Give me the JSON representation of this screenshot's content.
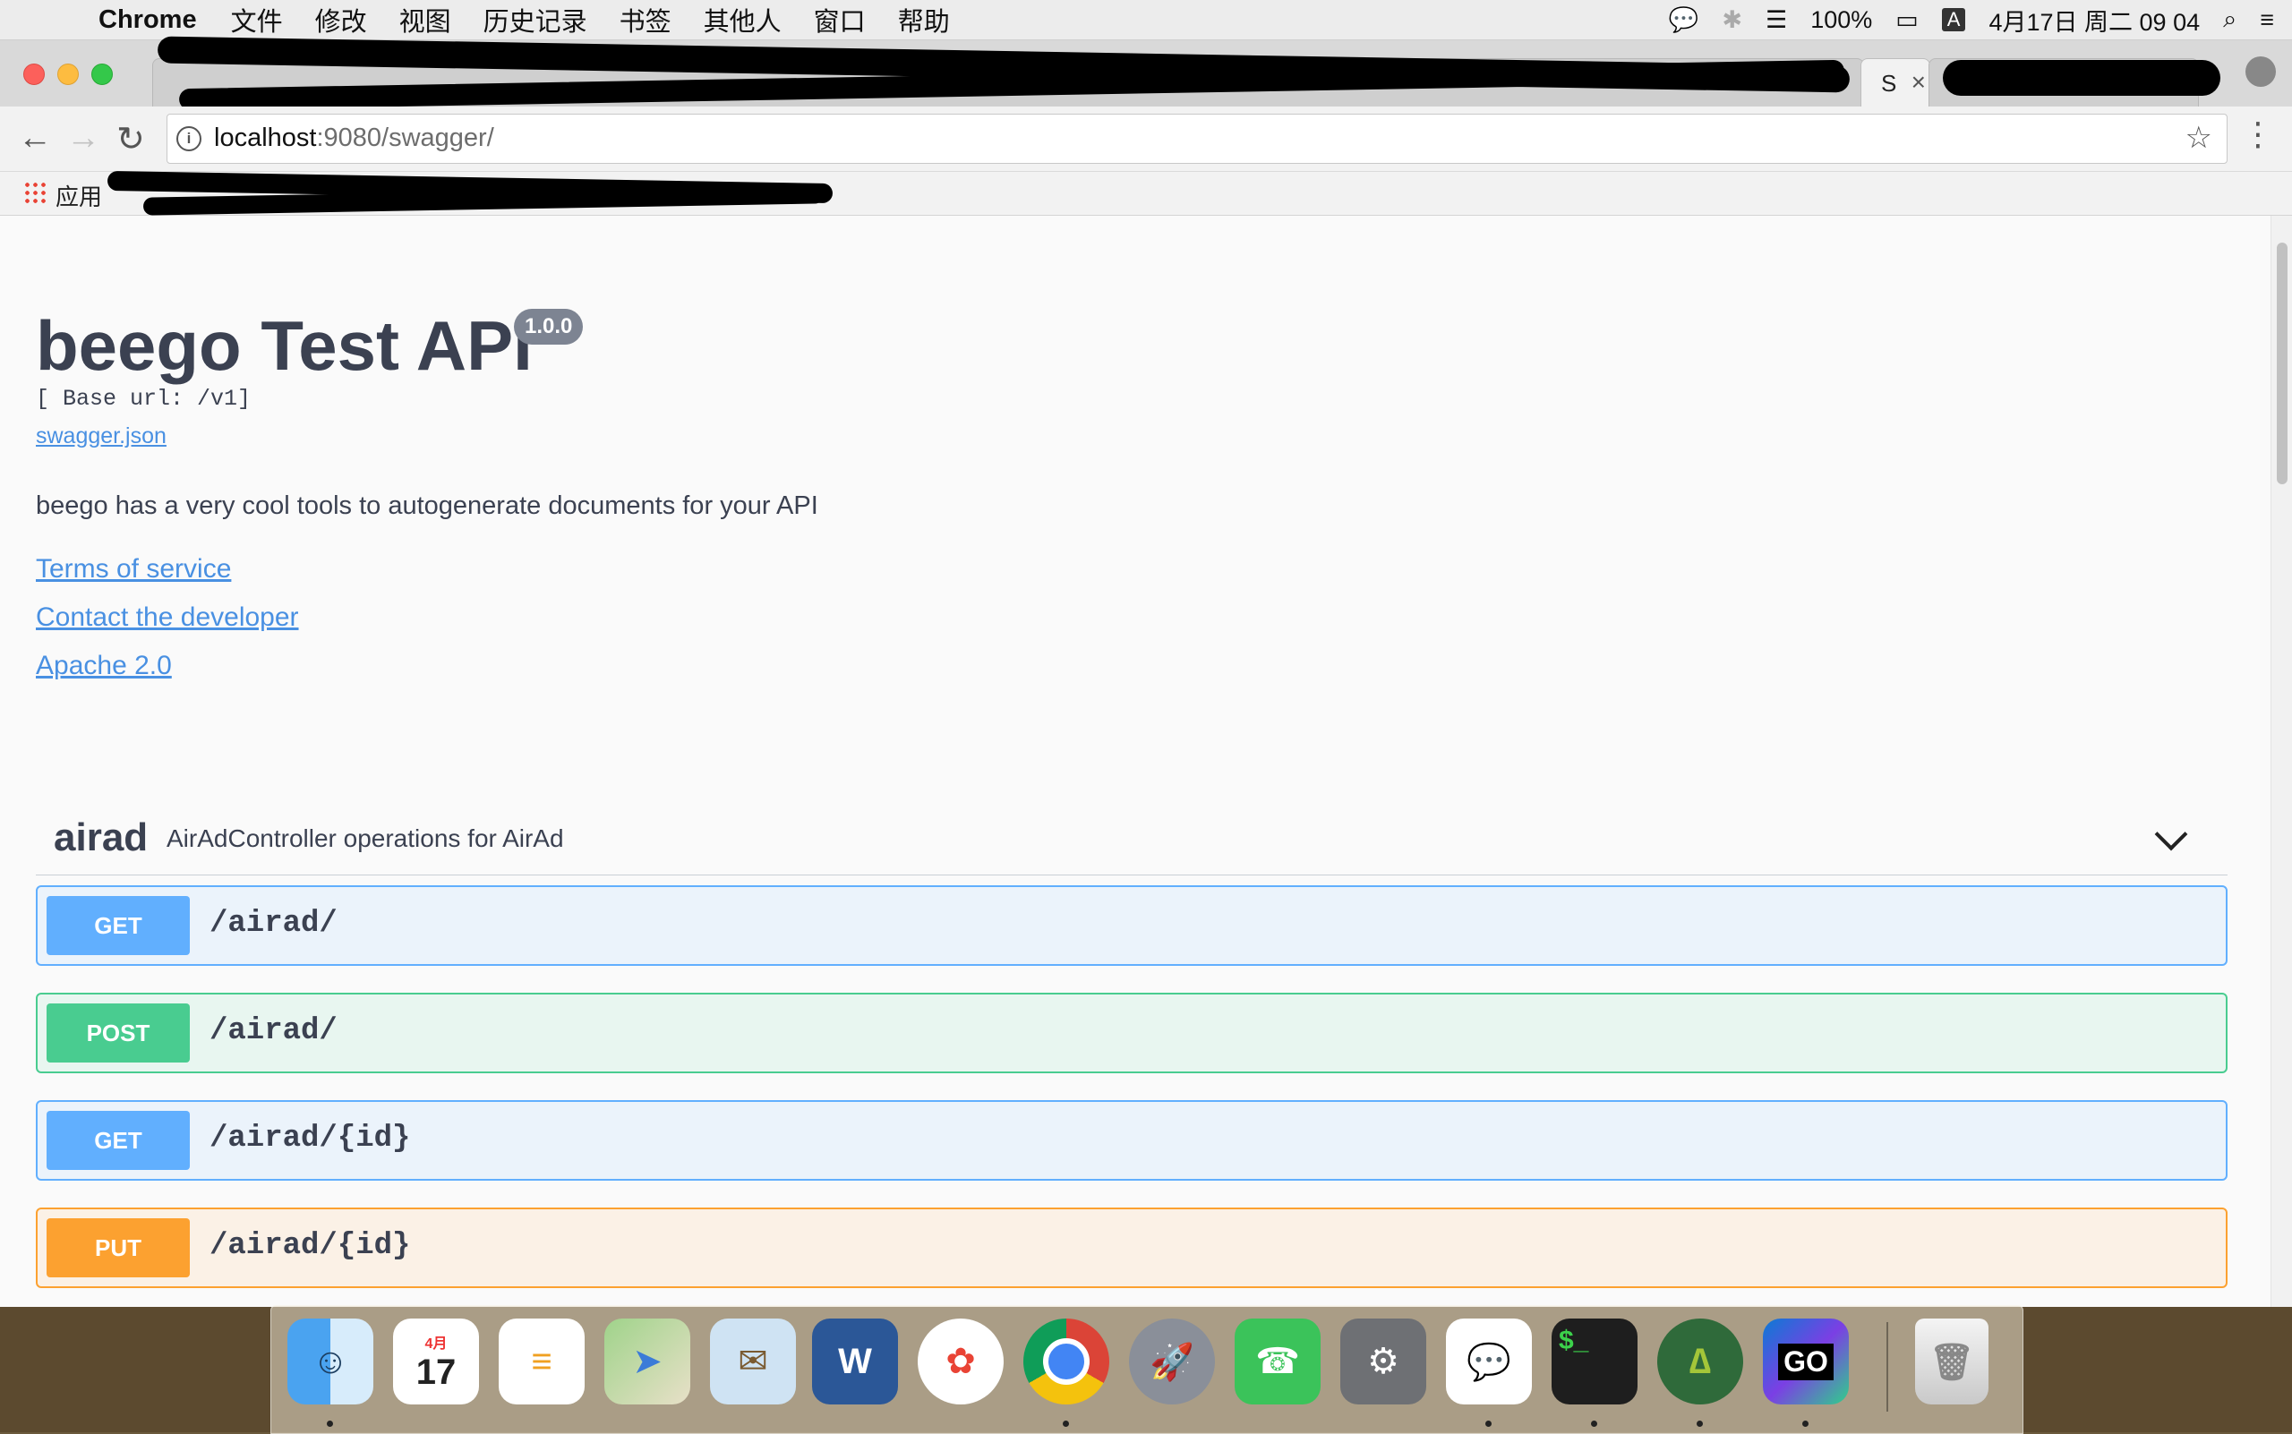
{
  "menubar": {
    "app_name": "Chrome",
    "items": [
      "文件",
      "修改",
      "视图",
      "历史记录",
      "书签",
      "其他人",
      "窗口",
      "帮助"
    ],
    "battery": "100%",
    "ime": "A",
    "datetime": "4月17日 周二  09 04"
  },
  "tabs": {
    "active_title": "S",
    "close_glyph": "×"
  },
  "omnibox": {
    "url_host": "localhost",
    "url_rest": ":9080/swagger/"
  },
  "bookmarks": {
    "apps_label": "应用"
  },
  "api": {
    "title": "beego Test API",
    "version": "1.0.0",
    "base_url": "[ Base url: /v1]",
    "spec_link": "swagger.json",
    "description": "beego has a very cool tools to autogenerate documents for your API",
    "terms_link": "Terms of service",
    "contact_link": "Contact the developer",
    "license_link": "Apache 2.0"
  },
  "tag": {
    "name": "airad",
    "description": "AirAdController operations for AirAd"
  },
  "operations": [
    {
      "method": "GET",
      "path": "/airad/"
    },
    {
      "method": "POST",
      "path": "/airad/"
    },
    {
      "method": "GET",
      "path": "/airad/{id}"
    },
    {
      "method": "PUT",
      "path": "/airad/{id}"
    }
  ],
  "dock": {
    "calendar_month": "4月",
    "calendar_day": "17",
    "goland_label": "GO",
    "terminal_prompt": "$_"
  },
  "colors": {
    "get": "#61affe",
    "post": "#49cc90",
    "put": "#fca130",
    "link": "#4990e2",
    "text": "#3b4151"
  }
}
